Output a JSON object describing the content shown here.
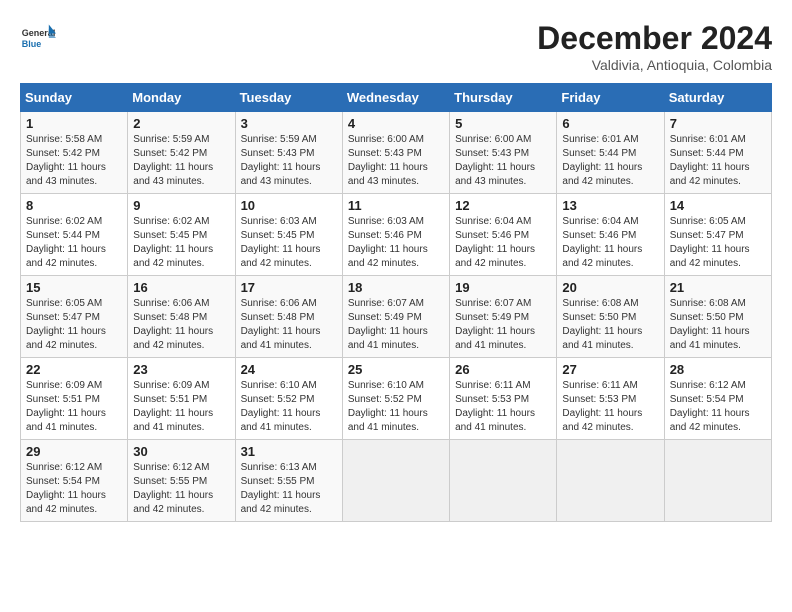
{
  "header": {
    "logo_general": "General",
    "logo_blue": "Blue",
    "month_year": "December 2024",
    "location": "Valdivia, Antioquia, Colombia"
  },
  "days_of_week": [
    "Sunday",
    "Monday",
    "Tuesday",
    "Wednesday",
    "Thursday",
    "Friday",
    "Saturday"
  ],
  "weeks": [
    [
      {
        "day": "1",
        "sunrise": "5:58 AM",
        "sunset": "5:42 PM",
        "daylight": "11 hours and 43 minutes."
      },
      {
        "day": "2",
        "sunrise": "5:59 AM",
        "sunset": "5:42 PM",
        "daylight": "11 hours and 43 minutes."
      },
      {
        "day": "3",
        "sunrise": "5:59 AM",
        "sunset": "5:43 PM",
        "daylight": "11 hours and 43 minutes."
      },
      {
        "day": "4",
        "sunrise": "6:00 AM",
        "sunset": "5:43 PM",
        "daylight": "11 hours and 43 minutes."
      },
      {
        "day": "5",
        "sunrise": "6:00 AM",
        "sunset": "5:43 PM",
        "daylight": "11 hours and 43 minutes."
      },
      {
        "day": "6",
        "sunrise": "6:01 AM",
        "sunset": "5:44 PM",
        "daylight": "11 hours and 42 minutes."
      },
      {
        "day": "7",
        "sunrise": "6:01 AM",
        "sunset": "5:44 PM",
        "daylight": "11 hours and 42 minutes."
      }
    ],
    [
      {
        "day": "8",
        "sunrise": "6:02 AM",
        "sunset": "5:44 PM",
        "daylight": "11 hours and 42 minutes."
      },
      {
        "day": "9",
        "sunrise": "6:02 AM",
        "sunset": "5:45 PM",
        "daylight": "11 hours and 42 minutes."
      },
      {
        "day": "10",
        "sunrise": "6:03 AM",
        "sunset": "5:45 PM",
        "daylight": "11 hours and 42 minutes."
      },
      {
        "day": "11",
        "sunrise": "6:03 AM",
        "sunset": "5:46 PM",
        "daylight": "11 hours and 42 minutes."
      },
      {
        "day": "12",
        "sunrise": "6:04 AM",
        "sunset": "5:46 PM",
        "daylight": "11 hours and 42 minutes."
      },
      {
        "day": "13",
        "sunrise": "6:04 AM",
        "sunset": "5:46 PM",
        "daylight": "11 hours and 42 minutes."
      },
      {
        "day": "14",
        "sunrise": "6:05 AM",
        "sunset": "5:47 PM",
        "daylight": "11 hours and 42 minutes."
      }
    ],
    [
      {
        "day": "15",
        "sunrise": "6:05 AM",
        "sunset": "5:47 PM",
        "daylight": "11 hours and 42 minutes."
      },
      {
        "day": "16",
        "sunrise": "6:06 AM",
        "sunset": "5:48 PM",
        "daylight": "11 hours and 42 minutes."
      },
      {
        "day": "17",
        "sunrise": "6:06 AM",
        "sunset": "5:48 PM",
        "daylight": "11 hours and 41 minutes."
      },
      {
        "day": "18",
        "sunrise": "6:07 AM",
        "sunset": "5:49 PM",
        "daylight": "11 hours and 41 minutes."
      },
      {
        "day": "19",
        "sunrise": "6:07 AM",
        "sunset": "5:49 PM",
        "daylight": "11 hours and 41 minutes."
      },
      {
        "day": "20",
        "sunrise": "6:08 AM",
        "sunset": "5:50 PM",
        "daylight": "11 hours and 41 minutes."
      },
      {
        "day": "21",
        "sunrise": "6:08 AM",
        "sunset": "5:50 PM",
        "daylight": "11 hours and 41 minutes."
      }
    ],
    [
      {
        "day": "22",
        "sunrise": "6:09 AM",
        "sunset": "5:51 PM",
        "daylight": "11 hours and 41 minutes."
      },
      {
        "day": "23",
        "sunrise": "6:09 AM",
        "sunset": "5:51 PM",
        "daylight": "11 hours and 41 minutes."
      },
      {
        "day": "24",
        "sunrise": "6:10 AM",
        "sunset": "5:52 PM",
        "daylight": "11 hours and 41 minutes."
      },
      {
        "day": "25",
        "sunrise": "6:10 AM",
        "sunset": "5:52 PM",
        "daylight": "11 hours and 41 minutes."
      },
      {
        "day": "26",
        "sunrise": "6:11 AM",
        "sunset": "5:53 PM",
        "daylight": "11 hours and 41 minutes."
      },
      {
        "day": "27",
        "sunrise": "6:11 AM",
        "sunset": "5:53 PM",
        "daylight": "11 hours and 42 minutes."
      },
      {
        "day": "28",
        "sunrise": "6:12 AM",
        "sunset": "5:54 PM",
        "daylight": "11 hours and 42 minutes."
      }
    ],
    [
      {
        "day": "29",
        "sunrise": "6:12 AM",
        "sunset": "5:54 PM",
        "daylight": "11 hours and 42 minutes."
      },
      {
        "day": "30",
        "sunrise": "6:12 AM",
        "sunset": "5:55 PM",
        "daylight": "11 hours and 42 minutes."
      },
      {
        "day": "31",
        "sunrise": "6:13 AM",
        "sunset": "5:55 PM",
        "daylight": "11 hours and 42 minutes."
      },
      null,
      null,
      null,
      null
    ]
  ]
}
